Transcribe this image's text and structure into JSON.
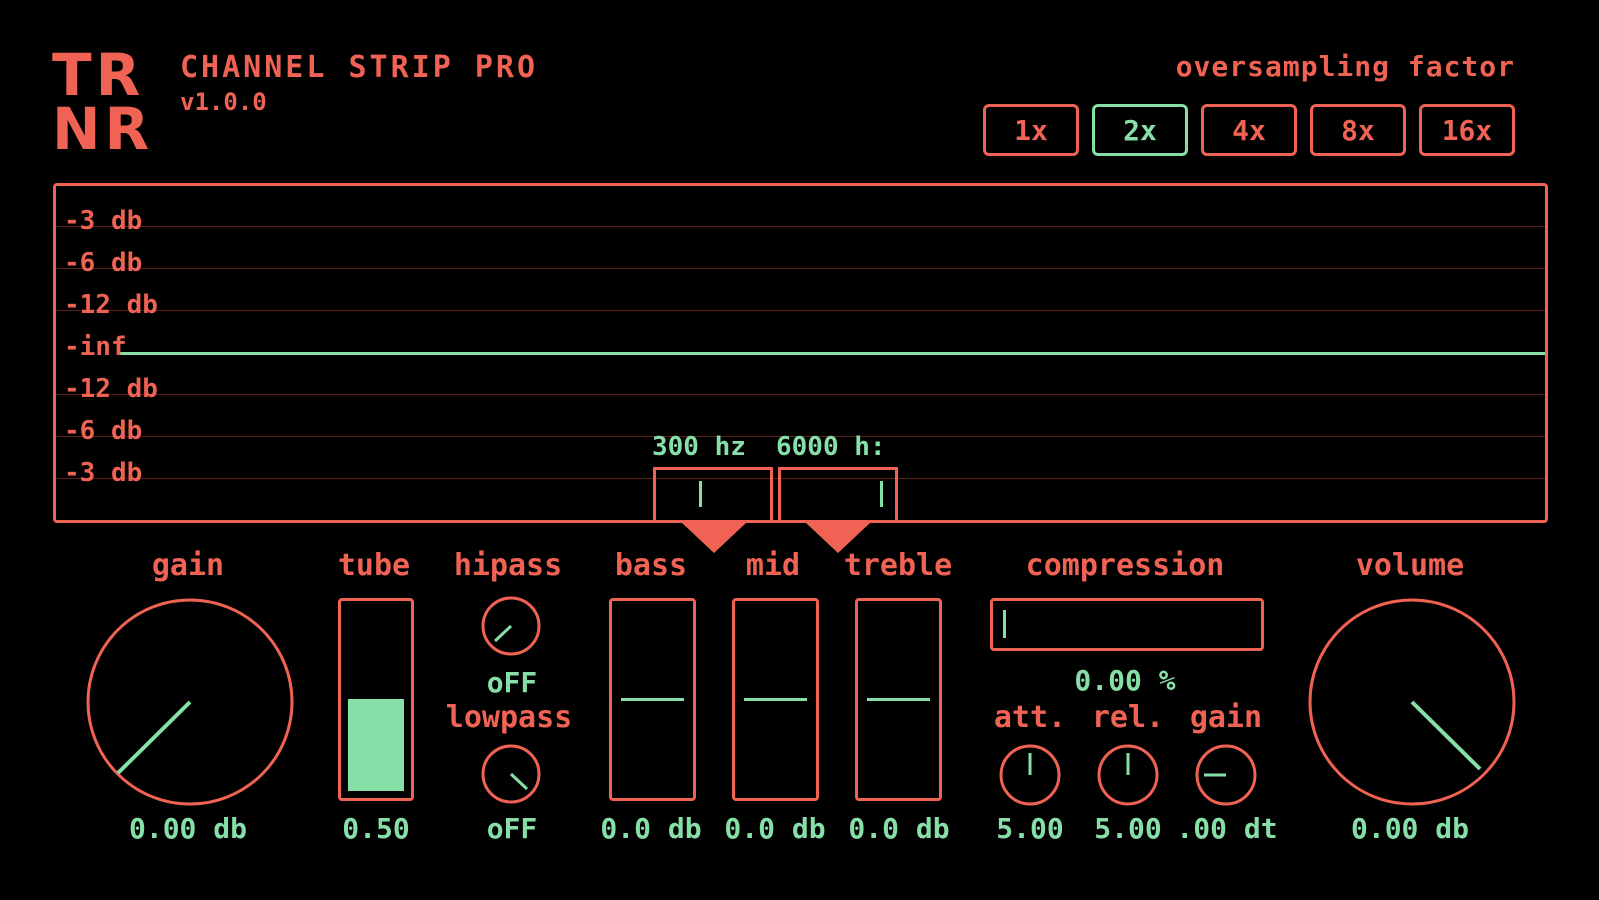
{
  "header": {
    "logo": "TR NR",
    "title": "CHANNEL STRIP PRO",
    "version": "v1.0.0"
  },
  "oversampling": {
    "label": "oversampling factor",
    "options": [
      "1x",
      "2x",
      "4x",
      "8x",
      "16x"
    ],
    "selected": "2x"
  },
  "display": {
    "scale_labels": [
      "-3 db",
      "-6 db",
      "-12 db",
      "-inf",
      "-12 db",
      "-6 db",
      "-3 db"
    ],
    "low_split": "300 hz",
    "high_split": "6000 h:"
  },
  "controls": {
    "gain": {
      "label": "gain",
      "value": "0.00 db"
    },
    "tube": {
      "label": "tube",
      "value": "0.50",
      "level": 0.5
    },
    "hipass": {
      "label": "hipass",
      "value": "oFF"
    },
    "lowpass": {
      "label": "lowpass",
      "value": "oFF"
    },
    "bass": {
      "label": "bass",
      "value": "0.0 db"
    },
    "mid": {
      "label": "mid",
      "value": "0.0 db"
    },
    "treble": {
      "label": "treble",
      "value": "0.0 db"
    },
    "compression": {
      "label": "compression",
      "value": "0.00 %"
    },
    "attack": {
      "label": "att.",
      "value": "5.00"
    },
    "release": {
      "label": "rel.",
      "value": "5.00"
    },
    "comp_gain": {
      "label": "gain",
      "value": ".00 dt"
    },
    "volume": {
      "label": "volume",
      "value": "0.00 db"
    }
  },
  "colors": {
    "accent": "#f06253",
    "active": "#86dfa7",
    "background": "#000000"
  }
}
